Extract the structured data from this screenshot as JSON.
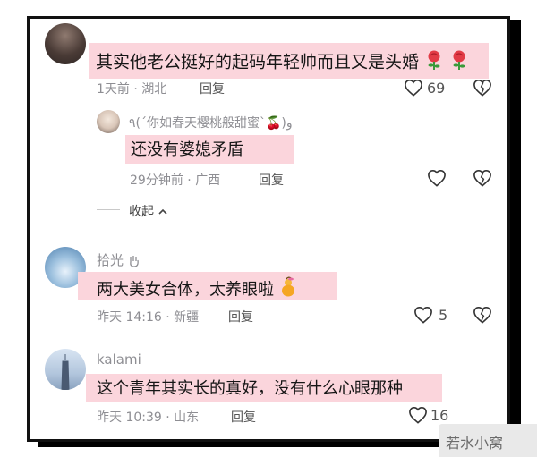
{
  "comments": [
    {
      "text": "其实他老公挺好的起码年轻帅而且又是头婚",
      "time": "1天前",
      "location": "湖北",
      "reply_label": "回复",
      "likes": "69",
      "emoji": [
        "rose-icon",
        "rose-icon"
      ]
    },
    {
      "user": "٩(´你如春天樱桃般甜蜜`🍒)و",
      "text": "还没有婆媳矛盾",
      "time": "29分钟前",
      "location": "广西",
      "reply_label": "回复"
    },
    {
      "user": "拾光",
      "text": "两大美女合体，太养眼啦",
      "time": "昨天 14:16",
      "location": "新疆",
      "reply_label": "回复",
      "likes": "5",
      "emoji": [
        "gourd-icon"
      ]
    },
    {
      "user": "kalami",
      "text": "这个青年其实长的真好，没有什么心眼那种",
      "time": "昨天 10:39",
      "location": "山东",
      "reply_label": "回复",
      "likes": "16"
    }
  ],
  "collapse_label": "收起",
  "watermark": "若水小窝",
  "colors": {
    "highlight": "#fbd5dc",
    "muted": "#8e8e93"
  }
}
